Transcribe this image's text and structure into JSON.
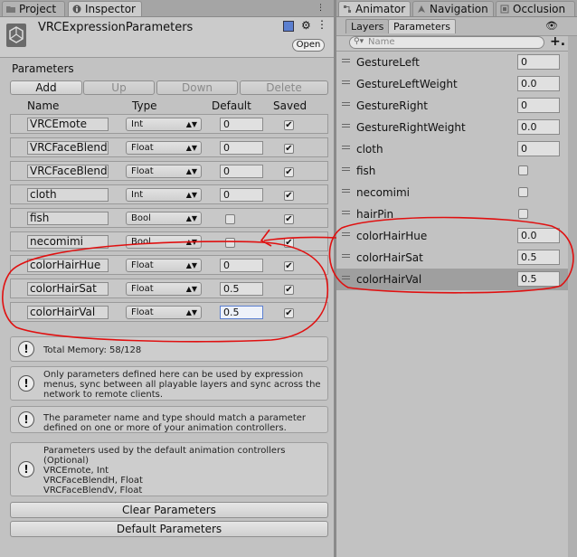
{
  "tabs_left": [
    {
      "label": "Project",
      "icon": "folder-icon"
    },
    {
      "label": "Inspector",
      "icon": "info-icon"
    }
  ],
  "tabs_right": [
    {
      "label": "Animator",
      "icon": "animator-icon"
    },
    {
      "label": "Navigation",
      "icon": "navigation-icon"
    },
    {
      "label": "Occlusion",
      "icon": "occlusion-icon"
    }
  ],
  "inspector": {
    "title": "VRCExpressionParameters",
    "open_button": "Open",
    "section_label": "Parameters",
    "buttons": {
      "add": "Add",
      "up": "Up",
      "down": "Down",
      "delete": "Delete"
    },
    "columns": {
      "name": "Name",
      "type": "Type",
      "default": "Default",
      "saved": "Saved"
    },
    "rows": [
      {
        "name": "VRCEmote",
        "type": "Int",
        "default": "0",
        "default_kind": "text",
        "saved": true
      },
      {
        "name": "VRCFaceBlend",
        "type": "Float",
        "default": "0",
        "default_kind": "text",
        "saved": true
      },
      {
        "name": "VRCFaceBlend",
        "type": "Float",
        "default": "0",
        "default_kind": "text",
        "saved": true
      },
      {
        "name": "cloth",
        "type": "Int",
        "default": "0",
        "default_kind": "text",
        "saved": true
      },
      {
        "name": "fish",
        "type": "Bool",
        "default": "",
        "default_kind": "check",
        "saved": true
      },
      {
        "name": "necomimi",
        "type": "Bool",
        "default": "",
        "default_kind": "check",
        "saved": true
      },
      {
        "name": "colorHairHue",
        "type": "Float",
        "default": "0",
        "default_kind": "text",
        "saved": true
      },
      {
        "name": "colorHairSat",
        "type": "Float",
        "default": "0.5",
        "default_kind": "text",
        "saved": true
      },
      {
        "name": "colorHairVal",
        "type": "Float",
        "default": "0.5",
        "default_kind": "text",
        "saved": true
      }
    ],
    "memory_text": "Total Memory: 58/128",
    "help1": [
      "Only parameters defined here can be used by expression",
      "menus, sync between all playable layers and sync across the",
      "network to remote clients."
    ],
    "help2": [
      "The parameter name and type should match a parameter",
      "defined on one or more of your animation controllers."
    ],
    "help3": [
      "Parameters used by the default animation controllers",
      "(Optional)",
      "VRCEmote, Int",
      "VRCFaceBlendH, Float",
      "VRCFaceBlendV, Float"
    ],
    "clear_button": "Clear Parameters",
    "default_button": "Default Parameters"
  },
  "animator": {
    "subtabs": [
      "Layers",
      "Parameters"
    ],
    "search_placeholder": "Name",
    "params": [
      {
        "name": "GestureLeft",
        "value": "0",
        "kind": "text"
      },
      {
        "name": "GestureLeftWeight",
        "value": "0.0",
        "kind": "text"
      },
      {
        "name": "GestureRight",
        "value": "0",
        "kind": "text"
      },
      {
        "name": "GestureRightWeight",
        "value": "0.0",
        "kind": "text"
      },
      {
        "name": "cloth",
        "value": "0",
        "kind": "text"
      },
      {
        "name": "fish",
        "value": "",
        "kind": "check"
      },
      {
        "name": "necomimi",
        "value": "",
        "kind": "check"
      },
      {
        "name": "hairPin",
        "value": "",
        "kind": "check"
      },
      {
        "name": "colorHairHue",
        "value": "0.0",
        "kind": "text"
      },
      {
        "name": "colorHairSat",
        "value": "0.5",
        "kind": "text"
      },
      {
        "name": "colorHairVal",
        "value": "0.5",
        "kind": "text"
      }
    ]
  },
  "annotation_color": "#e01010"
}
